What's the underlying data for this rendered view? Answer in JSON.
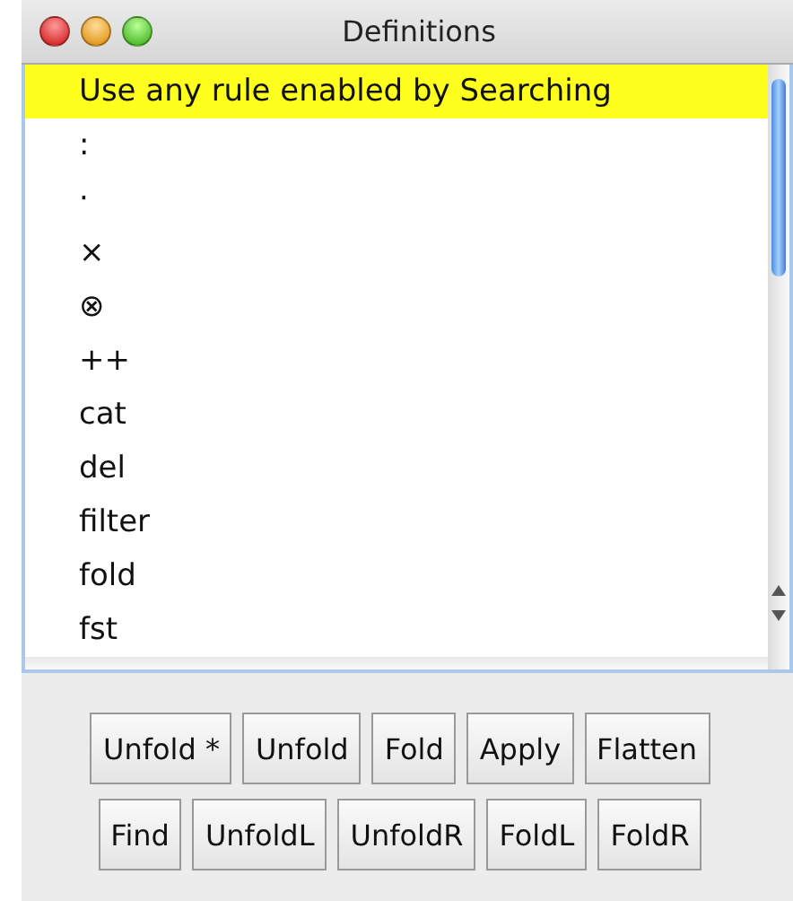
{
  "window": {
    "title": "Definitions"
  },
  "list": {
    "items": [
      {
        "label": "Use any rule enabled by Searching",
        "selected": true
      },
      {
        "label": ":",
        "selected": false
      },
      {
        "label": "·",
        "selected": false
      },
      {
        "label": "×",
        "selected": false
      },
      {
        "label": "⊗",
        "selected": false
      },
      {
        "label": "++",
        "selected": false
      },
      {
        "label": "cat",
        "selected": false
      },
      {
        "label": "del",
        "selected": false
      },
      {
        "label": "filter",
        "selected": false
      },
      {
        "label": "fold",
        "selected": false
      },
      {
        "label": "fst",
        "selected": false
      }
    ]
  },
  "button_rows": [
    [
      "Unfold *",
      "Unfold",
      "Fold",
      "Apply",
      "Flatten"
    ],
    [
      "Find",
      "UnfoldL",
      "UnfoldR",
      "FoldL",
      "FoldR"
    ]
  ]
}
